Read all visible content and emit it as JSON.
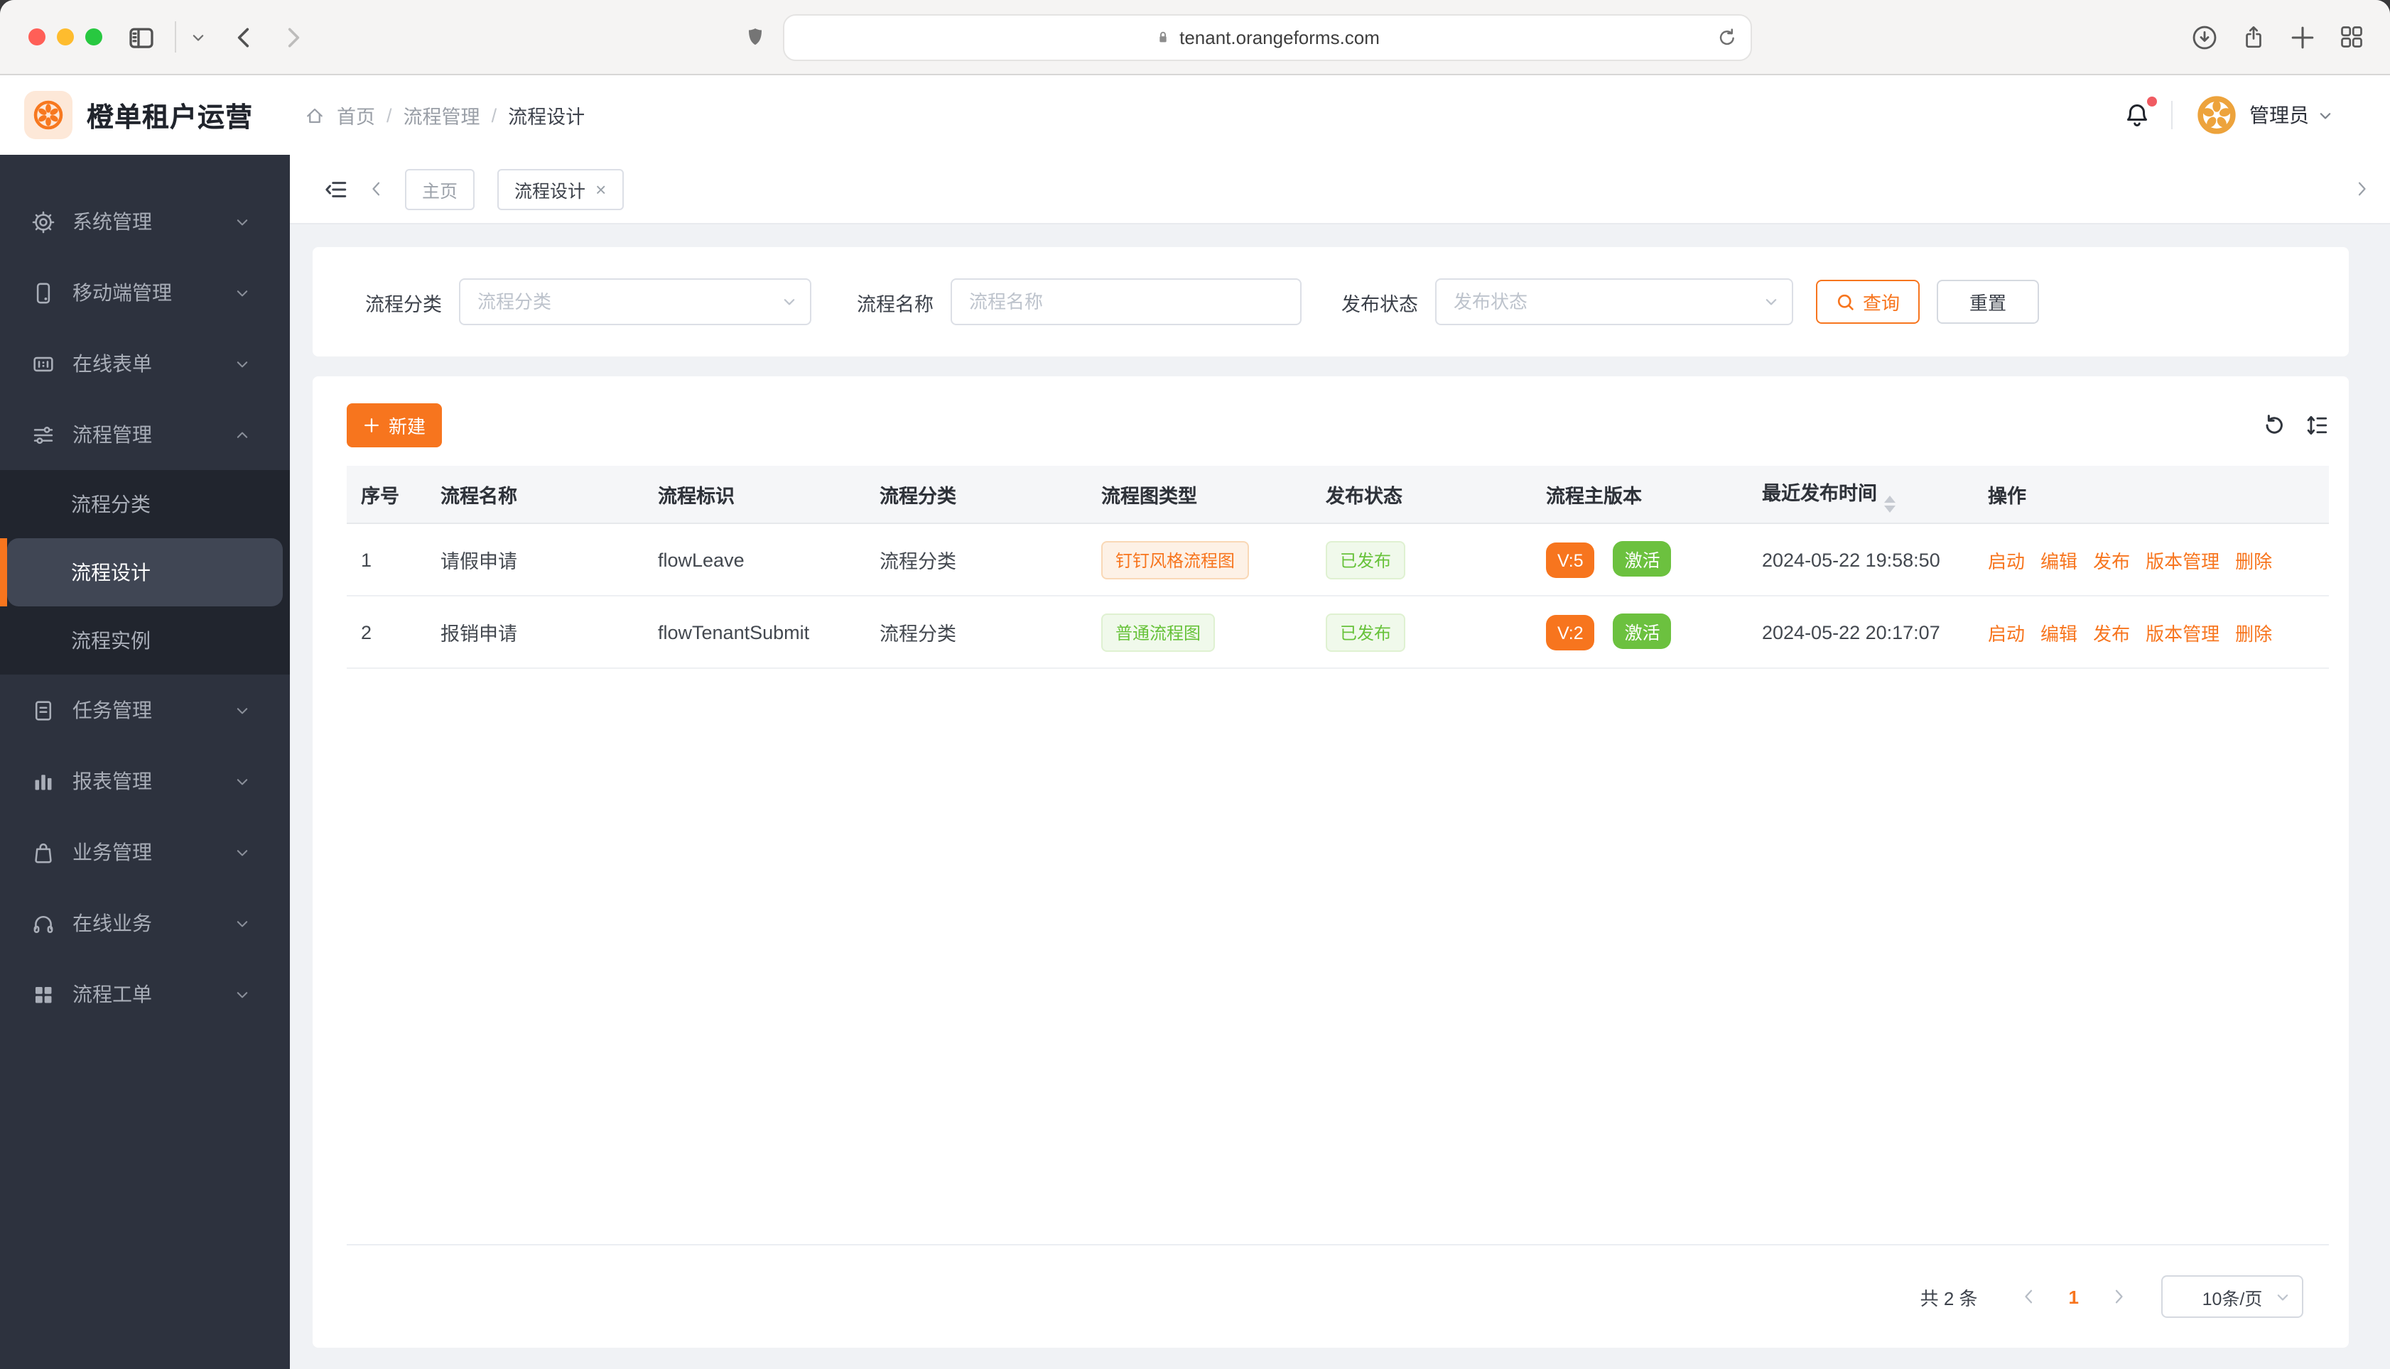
{
  "browser": {
    "url": "tenant.orangeforms.com"
  },
  "header": {
    "app_title": "橙单租户运营",
    "breadcrumb": [
      "首页",
      "流程管理",
      "流程设计"
    ],
    "user_name": "管理员"
  },
  "sidebar": {
    "items": [
      {
        "id": "system-management",
        "label": "系统管理",
        "icon": "gear-icon",
        "expanded": false
      },
      {
        "id": "mobile-management",
        "label": "移动端管理",
        "icon": "mobile-icon",
        "expanded": false
      },
      {
        "id": "online-form",
        "label": "在线表单",
        "icon": "form-icon",
        "expanded": false
      },
      {
        "id": "flow-management",
        "label": "流程管理",
        "icon": "sliders-icon",
        "expanded": true,
        "children": [
          {
            "id": "flow-category",
            "label": "流程分类",
            "active": false
          },
          {
            "id": "flow-design",
            "label": "流程设计",
            "active": true
          },
          {
            "id": "flow-instance",
            "label": "流程实例",
            "active": false
          }
        ]
      },
      {
        "id": "task-management",
        "label": "任务管理",
        "icon": "document-icon",
        "expanded": false
      },
      {
        "id": "report-management",
        "label": "报表管理",
        "icon": "bar-chart-icon",
        "expanded": false
      },
      {
        "id": "business-management",
        "label": "业务管理",
        "icon": "bag-icon",
        "expanded": false
      },
      {
        "id": "online-business",
        "label": "在线业务",
        "icon": "headset-icon",
        "expanded": false
      },
      {
        "id": "flow-ticket",
        "label": "流程工单",
        "icon": "grid-icon",
        "expanded": false
      }
    ]
  },
  "tabs": [
    {
      "label": "主页",
      "closable": false,
      "active": false
    },
    {
      "label": "流程设计",
      "closable": true,
      "active": true
    }
  ],
  "filters": {
    "fields": [
      {
        "label": "流程分类",
        "placeholder": "流程分类",
        "type": "select"
      },
      {
        "label": "流程名称",
        "placeholder": "流程名称",
        "type": "input"
      },
      {
        "label": "发布状态",
        "placeholder": "发布状态",
        "type": "select"
      }
    ],
    "search_label": "查询",
    "reset_label": "重置"
  },
  "toolbar": {
    "create_label": "新建"
  },
  "table": {
    "columns": [
      "序号",
      "流程名称",
      "流程标识",
      "流程分类",
      "流程图类型",
      "发布状态",
      "流程主版本",
      "最近发布时间",
      "操作"
    ],
    "sortable_column": "最近发布时间",
    "rows": [
      {
        "index": "1",
        "name": "请假申请",
        "key": "flowLeave",
        "category": "流程分类",
        "diagram": {
          "label": "钉钉风格流程图",
          "theme": "orange"
        },
        "status": {
          "label": "已发布",
          "theme": "green"
        },
        "version": "V:5",
        "active_label": "激活",
        "published_at": "2024-05-22 19:58:50",
        "actions": [
          "启动",
          "编辑",
          "发布",
          "版本管理",
          "删除"
        ]
      },
      {
        "index": "2",
        "name": "报销申请",
        "key": "flowTenantSubmit",
        "category": "流程分类",
        "diagram": {
          "label": "普通流程图",
          "theme": "green"
        },
        "status": {
          "label": "已发布",
          "theme": "green"
        },
        "version": "V:2",
        "active_label": "激活",
        "published_at": "2024-05-22 20:17:07",
        "actions": [
          "启动",
          "编辑",
          "发布",
          "版本管理",
          "删除"
        ]
      }
    ]
  },
  "pagination": {
    "total_label": "共 2 条",
    "current_page": "1",
    "page_size": "10条/页"
  },
  "colors": {
    "accent_orange": "#f7751e",
    "success_green": "#67c23a",
    "version_tag_bg": "#f7751e",
    "active_tag_bg": "#6cc13f",
    "sidebar_bg": "#2d323e",
    "sidebar_submenu_bg": "#21252e",
    "sidebar_selected_bg": "#404654"
  }
}
